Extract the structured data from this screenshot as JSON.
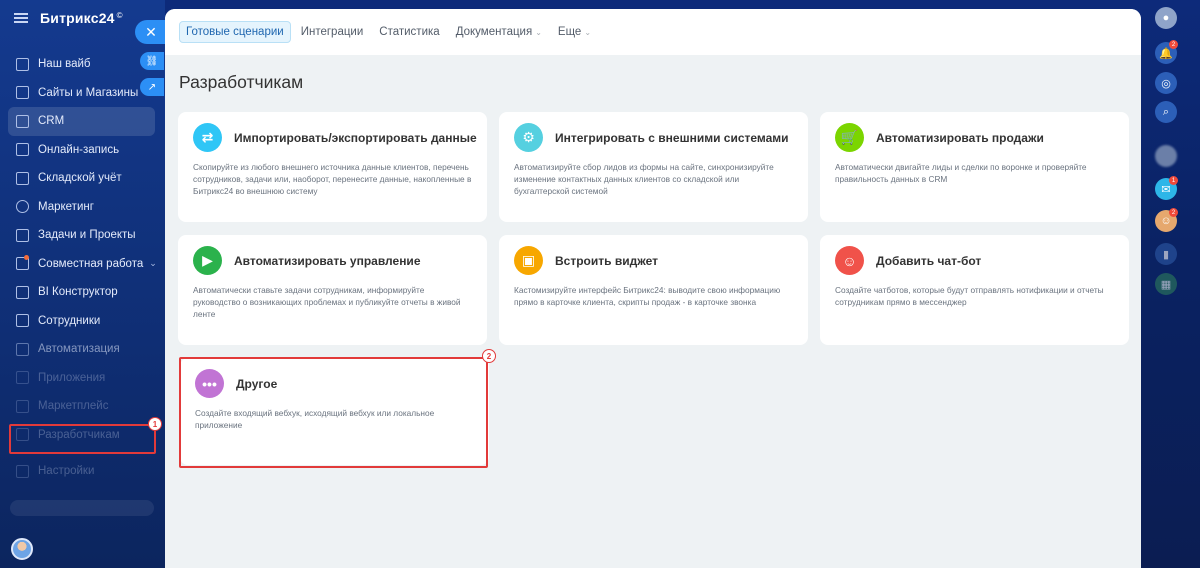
{
  "app": {
    "logo": "Битрикс24",
    "logo_mark": "©"
  },
  "sidebar": {
    "items": [
      {
        "label": "Наш вайб"
      },
      {
        "label": "Сайты и Магазины"
      },
      {
        "label": "CRM"
      },
      {
        "label": "Онлайн-запись"
      },
      {
        "label": "Складской учёт"
      },
      {
        "label": "Маркетинг"
      },
      {
        "label": "Задачи и Проекты"
      },
      {
        "label": "Совместная работа"
      },
      {
        "label": "BI Конструктор"
      },
      {
        "label": "Сотрудники"
      },
      {
        "label": "Автоматизация"
      },
      {
        "label": "Приложения"
      },
      {
        "label": "Маркетплейс"
      },
      {
        "label": "Разработчикам"
      },
      {
        "label": "Настройки"
      }
    ],
    "close_glyph": "✕"
  },
  "steps": {
    "one": "1",
    "two": "2"
  },
  "tabs": [
    {
      "label": "Готовые сценарии"
    },
    {
      "label": "Интеграции"
    },
    {
      "label": "Статистика"
    },
    {
      "label": "Документация"
    },
    {
      "label": "Еще"
    }
  ],
  "page": {
    "title": "Разработчикам"
  },
  "cards": [
    {
      "title": "Импортировать/экспортировать данные",
      "desc": "Скопируйте из любого внешнего источника данные клиентов, перечень сотрудников, задачи или, наоборот, перенесите данные, накопленные в Битрикс24 во внешнюю систему",
      "icon": "arrows-exchange-icon",
      "color": "#2fc6f6"
    },
    {
      "title": "Интегрировать с внешними системами",
      "desc": "Автоматизируйте сбор лидов из формы на сайте, синхронизируйте изменение контактных данных клиентов со складской или бухгалтерской системой",
      "icon": "gears-icon",
      "color": "#55d0e0"
    },
    {
      "title": "Автоматизировать продажи",
      "desc": "Автоматически двигайте лиды и сделки по воронке и проверяйте правильность данных в CRM",
      "icon": "cart-icon",
      "color": "#7bd500"
    },
    {
      "title": "Автоматизировать управление",
      "desc": "Автоматически ставьте задачи сотрудникам, информируйте руководство о возникающих проблемах и публикуйте отчеты в живой ленте",
      "icon": "play-icon",
      "color": "#2bb24c"
    },
    {
      "title": "Встроить виджет",
      "desc": "Кастомизируйте интерфейс Битрикс24: выводите свою информацию прямо в карточке клиента, скрипты продаж - в карточке звонка",
      "icon": "widget-icon",
      "color": "#f7a700"
    },
    {
      "title": "Добавить чат-бот",
      "desc": "Создайте чатботов, которые будут отправлять нотификации и отчеты сотрудникам прямо в мессенджер",
      "icon": "bot-icon",
      "color": "#f0524a"
    },
    {
      "title": "Другое",
      "desc": "Создайте входящий вебхук, исходящий вебхук или локальное приложение",
      "icon": "more-dots-icon",
      "color": "#c174d4"
    }
  ],
  "rightbar": {
    "badges": {
      "notifications": "2",
      "chat": "1",
      "avatar": "2"
    }
  }
}
